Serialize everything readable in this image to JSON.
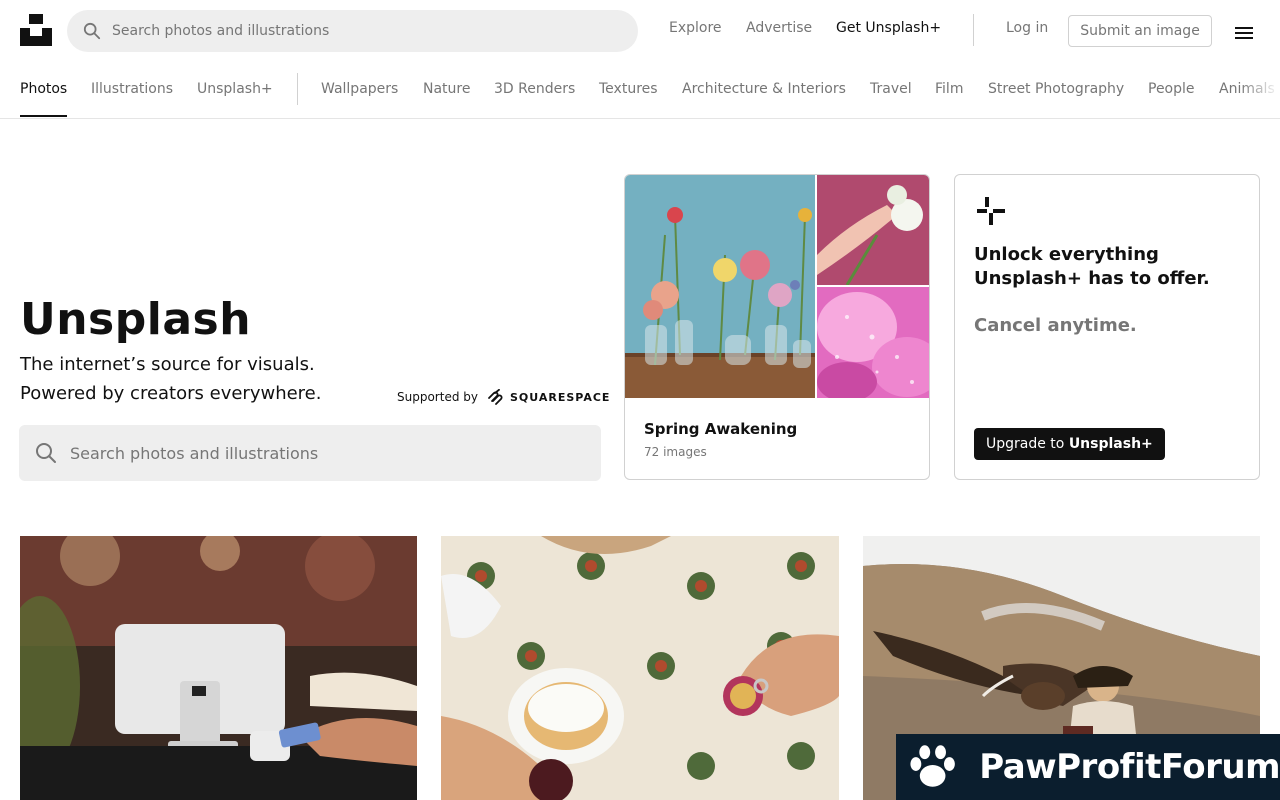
{
  "header": {
    "search_placeholder": "Search photos and illustrations",
    "nav": [
      "Explore",
      "Advertise",
      "Get Unsplash+"
    ],
    "login": "Log in",
    "submit": "Submit an image"
  },
  "topics": {
    "primary": [
      "Photos",
      "Illustrations",
      "Unsplash+"
    ],
    "secondary": [
      "Wallpapers",
      "Nature",
      "3D Renders",
      "Textures",
      "Architecture & Interiors",
      "Travel",
      "Film",
      "Street Photography",
      "People",
      "Animals"
    ],
    "active": "Photos"
  },
  "hero": {
    "title": "Unsplash",
    "line1": "The internet’s source for visuals.",
    "line2": "Powered by creators everywhere.",
    "supported_by": "Supported by",
    "sponsor": "SQUARESPACE",
    "search_placeholder": "Search photos and illustrations"
  },
  "collection": {
    "title": "Spring Awakening",
    "count": "72 images"
  },
  "plus": {
    "headline": "Unlock everything Unsplash+ has to offer.",
    "cancel": "Cancel anytime.",
    "button_prefix": "Upgrade to ",
    "button_bold": "Unsplash+"
  },
  "watermark": "PawProfitForum",
  "colors": {
    "accent": "#111111",
    "muted": "#767676",
    "search_bg": "#eeeeee",
    "border": "#d1d1d1",
    "watermark_bg": "#0b1e2e"
  }
}
